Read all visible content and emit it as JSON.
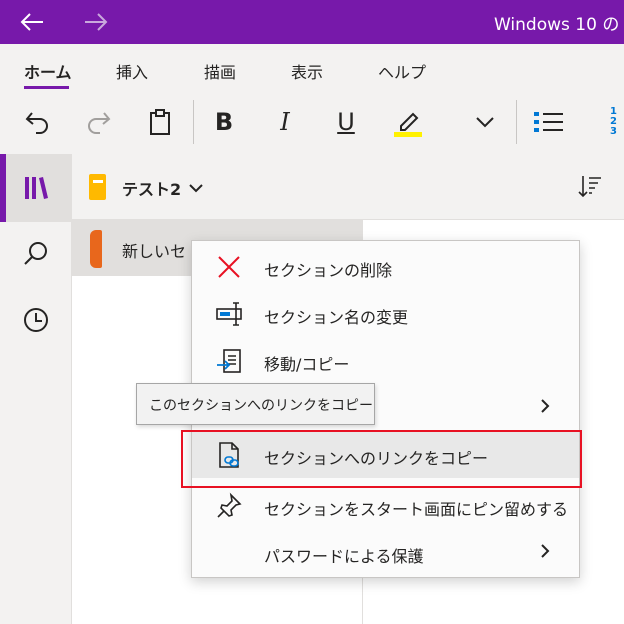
{
  "window": {
    "title": "Windows 10 の"
  },
  "ribbon": {
    "tabs": [
      {
        "label": "ホーム"
      },
      {
        "label": "挿入"
      },
      {
        "label": "描画"
      },
      {
        "label": "表示"
      },
      {
        "label": "ヘルプ"
      }
    ],
    "bold_glyph": "B",
    "italic_glyph": "I",
    "underline_glyph": "U",
    "highlight_color": "#fff100",
    "numbered_glyph": "1 2 3"
  },
  "notebook": {
    "name": "テスト2"
  },
  "sections": [
    {
      "name": "新しいセ",
      "color": "#e8671c"
    }
  ],
  "context_menu": {
    "items": [
      {
        "label": "セクションの削除",
        "icon": "close-icon"
      },
      {
        "label": "セクション名の変更",
        "icon": "rename-icon"
      },
      {
        "label": "移動/コピー",
        "icon": "move-copy-icon"
      },
      {
        "label": "",
        "icon": "",
        "has_submenu": true
      },
      {
        "label": "セクションへのリンクをコピー",
        "icon": "link-copy-icon"
      },
      {
        "label": "セクションをスタート画面にピン留めする",
        "icon": "pin-icon"
      },
      {
        "label": "パスワードによる保護",
        "icon": "",
        "has_submenu": true
      }
    ]
  },
  "tooltip": {
    "text": "このセクションへのリンクをコピー"
  },
  "colors": {
    "brand": "#7719aa",
    "delete": "#e81123",
    "accent_blue": "#0078d4",
    "highlight_border": "#e81123"
  }
}
